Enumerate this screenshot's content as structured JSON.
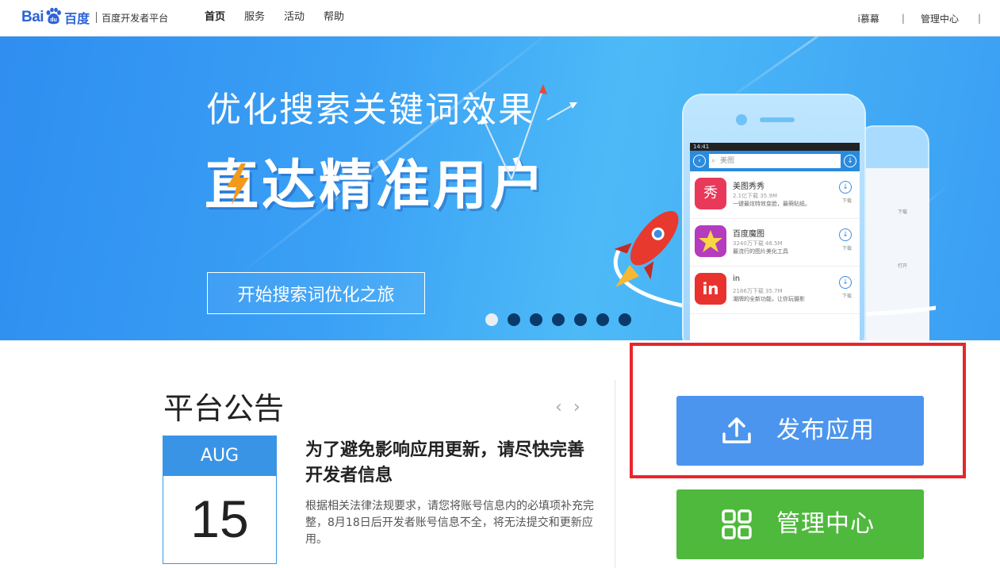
{
  "header": {
    "logo": {
      "text_bai": "Bai",
      "text_du": "du",
      "text_cn": "百度",
      "subtitle": "百度开发者平台"
    },
    "nav": [
      {
        "label": "首页",
        "active": true
      },
      {
        "label": "服务",
        "active": false
      },
      {
        "label": "活动",
        "active": false
      },
      {
        "label": "帮助",
        "active": false
      }
    ],
    "right": {
      "user": "i慕幕",
      "sep": "|",
      "admin": "管理中心",
      "sep2": "|"
    }
  },
  "banner": {
    "title1": "优化搜索关键词效果",
    "title2": "直达精准用户",
    "cta": "开始搜索词优化之旅",
    "slide_count": 7,
    "active_slide": 0,
    "phone": {
      "status_time": "14:41",
      "search_placeholder": "美图",
      "apps": [
        {
          "name": "美图秀秀",
          "meta": "2.1亿下载  35.9M",
          "desc": "一键最炫特效变脸，最萌贴纸。",
          "action": "下载",
          "icon_color": "#e8395a"
        },
        {
          "name": "百度魔图",
          "meta": "3240万下载  46.5M",
          "desc": "最流行的图片美化工具",
          "action": "下载",
          "icon_color": "#b53bbf"
        },
        {
          "name": "in",
          "meta": "2186万下载  35.7M",
          "desc": "潮牌的全新功能，让你玩摄影",
          "action": "下载",
          "icon_color": "#e9322e"
        }
      ],
      "back_phone_actions": [
        "下载",
        "打开"
      ]
    }
  },
  "notice": {
    "heading": "平台公告",
    "prev": "‹",
    "next": "›",
    "month": "AUG",
    "day": "15",
    "title": "为了避免影响应用更新，请尽快完善开发者信息",
    "body": "根据相关法律法规要求，请您将账号信息内的必填项补充完整，8月18日后开发者账号信息不全，将无法提交和更新应用。"
  },
  "actions": {
    "publish": {
      "label": "发布应用",
      "color": "#4b95ef",
      "icon": "upload-icon"
    },
    "manage": {
      "label": "管理中心",
      "color": "#4fb93d",
      "icon": "grid-icon"
    },
    "highlight_color": "#e8262b"
  }
}
